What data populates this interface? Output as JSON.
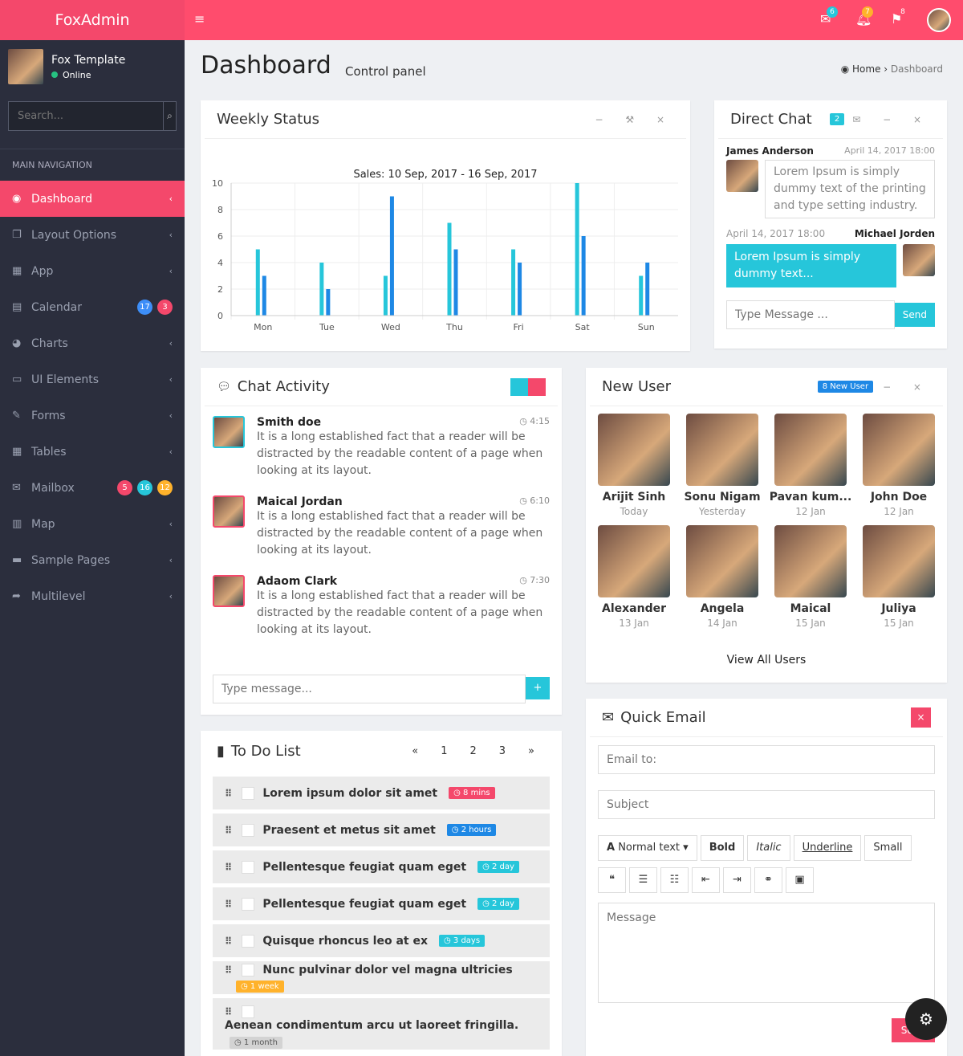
{
  "app": {
    "brand": "FoxAdmin"
  },
  "user": {
    "name": "Fox Template",
    "status": "Online"
  },
  "search": {
    "placeholder": "Search..."
  },
  "nav": {
    "header": "MAIN NAVIGATION",
    "items": [
      {
        "label": "Dashboard",
        "icon": "dashboard-icon",
        "glyph": "◉"
      },
      {
        "label": "Layout Options",
        "icon": "files-icon",
        "glyph": "❐"
      },
      {
        "label": "App",
        "icon": "grid-icon",
        "glyph": "▦"
      },
      {
        "label": "Calendar",
        "icon": "calendar-icon",
        "glyph": "▤",
        "badges": [
          {
            "text": "17",
            "color": "#3d8ef8"
          },
          {
            "text": "3",
            "color": "#f4486b"
          }
        ]
      },
      {
        "label": "Charts",
        "icon": "pie-chart-icon",
        "glyph": "◕"
      },
      {
        "label": "UI Elements",
        "icon": "laptop-icon",
        "glyph": "▭"
      },
      {
        "label": "Forms",
        "icon": "edit-icon",
        "glyph": "✎"
      },
      {
        "label": "Tables",
        "icon": "table-icon",
        "glyph": "▦"
      },
      {
        "label": "Mailbox",
        "icon": "envelope-icon",
        "glyph": "✉",
        "badges": [
          {
            "text": "5",
            "color": "#f4486b"
          },
          {
            "text": "16",
            "color": "#26c6da"
          },
          {
            "text": "12",
            "color": "#ffb22b"
          }
        ]
      },
      {
        "label": "Map",
        "icon": "map-icon",
        "glyph": "▥"
      },
      {
        "label": "Sample Pages",
        "icon": "folder-icon",
        "glyph": "▬"
      },
      {
        "label": "Multilevel",
        "icon": "share-icon",
        "glyph": "➦"
      }
    ]
  },
  "topbar": {
    "mail_count": "6",
    "bell_count": "7",
    "flag_count": "8"
  },
  "page": {
    "title": "Dashboard",
    "subtitle": "Control panel",
    "breadcrumb": [
      "Home",
      "Dashboard"
    ]
  },
  "weekly": {
    "title": "Weekly Status"
  },
  "chart_data": {
    "type": "bar",
    "title": "Sales: 10 Sep, 2017 - 16 Sep, 2017",
    "categories": [
      "Mon",
      "Tue",
      "Wed",
      "Thu",
      "Fri",
      "Sat",
      "Sun"
    ],
    "series": [
      {
        "values": [
          5,
          4,
          3,
          7,
          5,
          10,
          3
        ],
        "color": "#26c6da"
      },
      {
        "values": [
          3,
          2,
          9,
          5,
          4,
          6,
          4
        ],
        "color": "#1e88e5"
      }
    ],
    "ylim": [
      0,
      10
    ],
    "yticks": [
      0,
      2,
      4,
      6,
      8,
      10
    ],
    "grid": true
  },
  "direct_chat": {
    "title": "Direct Chat",
    "count": "2",
    "messages": [
      {
        "name": "James Anderson",
        "time": "April 14, 2017 18:00",
        "text": "Lorem Ipsum is simply dummy text of the printing and type setting industry."
      },
      {
        "name": "Michael Jorden",
        "time": "April 14, 2017 18:00",
        "text": "Lorem Ipsum is simply dummy text..."
      }
    ],
    "placeholder": "Type Message ...",
    "send": "Send"
  },
  "chat_activity": {
    "title": "Chat Activity",
    "items": [
      {
        "name": "Smith doe",
        "time": "4:15",
        "text": "It is a long established fact that a reader will be distracted by the readable content of a page when looking at its layout.",
        "color": "#26c6da"
      },
      {
        "name": "Maical Jordan",
        "time": "6:10",
        "text": "It is a long established fact that a reader will be distracted by the readable content of a page when looking at its layout.",
        "color": "#f4486b"
      },
      {
        "name": "Adaom Clark",
        "time": "7:30",
        "text": "It is a long established fact that a reader will be distracted by the readable content of a page when looking at its layout.",
        "color": "#f4486b"
      }
    ],
    "placeholder": "Type message..."
  },
  "new_user": {
    "title": "New User",
    "badge": "8 New User",
    "view_all": "View All Users",
    "users": [
      {
        "name": "Arijit Sinh",
        "date": "Today"
      },
      {
        "name": "Sonu Nigam",
        "date": "Yesterday"
      },
      {
        "name": "Pavan kum...",
        "date": "12 Jan"
      },
      {
        "name": "John Doe",
        "date": "12 Jan"
      },
      {
        "name": "Alexander",
        "date": "13 Jan"
      },
      {
        "name": "Angela",
        "date": "14 Jan"
      },
      {
        "name": "Maical",
        "date": "15 Jan"
      },
      {
        "name": "Juliya",
        "date": "15 Jan"
      }
    ]
  },
  "todo": {
    "title": "To Do List",
    "pages": [
      "«",
      "1",
      "2",
      "3",
      "»"
    ],
    "items": [
      {
        "text": "Lorem ipsum dolor sit amet",
        "badge": "8 mins",
        "color": "#f4486b"
      },
      {
        "text": "Praesent et metus sit amet",
        "badge": "2 hours",
        "color": "#1e88e5"
      },
      {
        "text": "Pellentesque feugiat quam eget",
        "badge": "2 day",
        "color": "#26c6da"
      },
      {
        "text": "Pellentesque feugiat quam eget",
        "badge": "2 day",
        "color": "#26c6da"
      },
      {
        "text": "Quisque rhoncus leo at ex",
        "badge": "3 days",
        "color": "#26c6da"
      },
      {
        "text": "Nunc pulvinar dolor vel magna ultricies",
        "badge": "1 week",
        "color": "#ffb22b"
      },
      {
        "text": "Aenean condimentum arcu ut laoreet fringilla.",
        "badge": "1 month",
        "color": "#d3d3d3"
      }
    ]
  },
  "quick_email": {
    "title": "Quick Email",
    "email_placeholder": "Email to:",
    "subject_placeholder": "Subject",
    "message_placeholder": "Message",
    "toolbar": {
      "normal": "Normal text",
      "bold": "Bold",
      "italic": "Italic",
      "underline": "Underline",
      "small": "Small"
    },
    "send": "Send"
  }
}
